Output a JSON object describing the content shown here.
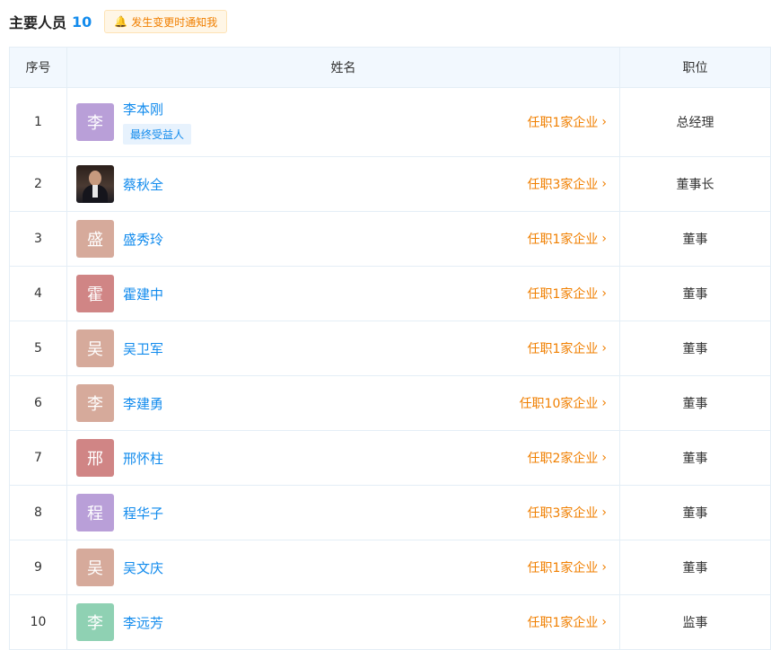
{
  "header": {
    "title": "主要人员",
    "count": "10",
    "notify_label": "发生变更时通知我"
  },
  "table": {
    "columns": [
      "序号",
      "姓名",
      "职位"
    ],
    "rows": [
      {
        "index": "1",
        "avatar_char": "李",
        "avatar_color": "#b99fd8",
        "name": "李本刚",
        "badge": "最终受益人",
        "companies": "任职1家企业",
        "position": "总经理"
      },
      {
        "index": "2",
        "avatar_char": "",
        "avatar_color": "photo",
        "name": "蔡秋全",
        "badge": "",
        "companies": "任职3家企业",
        "position": "董事长"
      },
      {
        "index": "3",
        "avatar_char": "盛",
        "avatar_color": "#d6aa9b",
        "name": "盛秀玲",
        "badge": "",
        "companies": "任职1家企业",
        "position": "董事"
      },
      {
        "index": "4",
        "avatar_char": "霍",
        "avatar_color": "#d08585",
        "name": "霍建中",
        "badge": "",
        "companies": "任职1家企业",
        "position": "董事"
      },
      {
        "index": "5",
        "avatar_char": "吴",
        "avatar_color": "#d6aa9b",
        "name": "吴卫军",
        "badge": "",
        "companies": "任职1家企业",
        "position": "董事"
      },
      {
        "index": "6",
        "avatar_char": "李",
        "avatar_color": "#d6aa9b",
        "name": "李建勇",
        "badge": "",
        "companies": "任职10家企业",
        "position": "董事"
      },
      {
        "index": "7",
        "avatar_char": "邢",
        "avatar_color": "#d08585",
        "name": "邢怀柱",
        "badge": "",
        "companies": "任职2家企业",
        "position": "董事"
      },
      {
        "index": "8",
        "avatar_char": "程",
        "avatar_color": "#b99fd8",
        "name": "程华子",
        "badge": "",
        "companies": "任职3家企业",
        "position": "董事"
      },
      {
        "index": "9",
        "avatar_char": "吴",
        "avatar_color": "#d6aa9b",
        "name": "吴文庆",
        "badge": "",
        "companies": "任职1家企业",
        "position": "董事"
      },
      {
        "index": "10",
        "avatar_char": "李",
        "avatar_color": "#8fd1b3",
        "name": "李远芳",
        "badge": "",
        "companies": "任职1家企业",
        "position": "监事"
      }
    ]
  },
  "icons": {
    "bell": "bell-icon",
    "chevron": "chevron-right-icon"
  },
  "colors": {
    "link_blue": "#128bed",
    "link_orange": "#f07f00",
    "header_bg": "#f2f8fe"
  }
}
